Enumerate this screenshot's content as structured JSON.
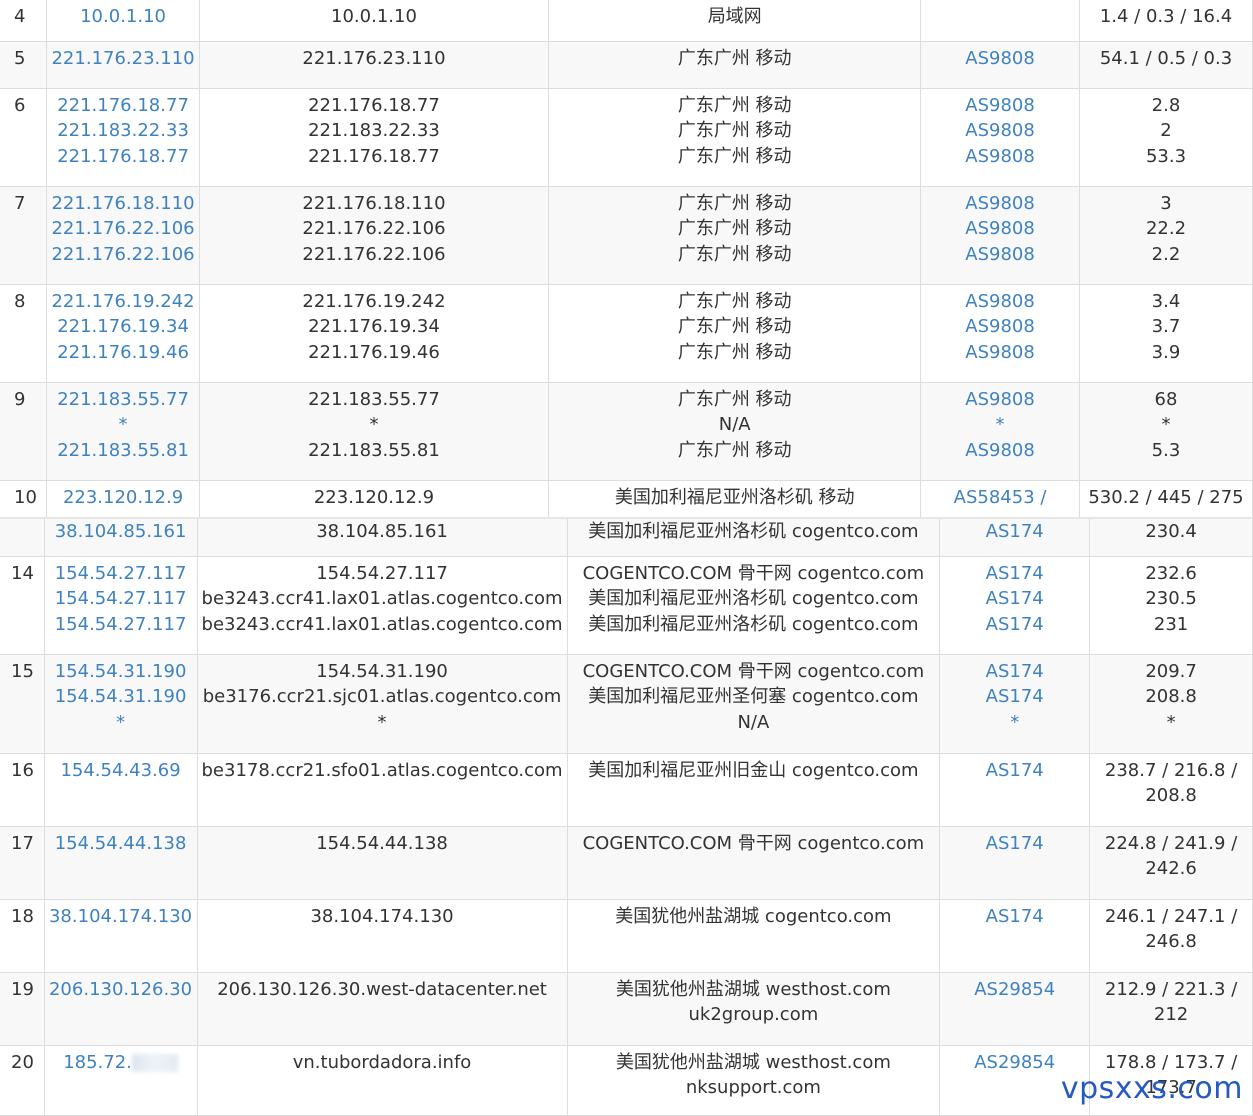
{
  "top_rows": [
    {
      "hop": "4",
      "ips": [
        "10.0.1.10"
      ],
      "hosts": [
        "10.0.1.10"
      ],
      "locs": [
        "局域网"
      ],
      "asns": [
        ""
      ],
      "times": [
        "1.4 / 0.3 / 16.4"
      ],
      "h": 41
    },
    {
      "hop": "5",
      "ips": [
        "221.176.23.110"
      ],
      "hosts": [
        "221.176.23.110"
      ],
      "locs": [
        "广东广州 移动"
      ],
      "asns": [
        "AS9808"
      ],
      "times": [
        "54.1 / 0.5 / 0.3"
      ],
      "h": 47
    },
    {
      "hop": "6",
      "ips": [
        "221.176.18.77",
        "221.183.22.33",
        "221.176.18.77"
      ],
      "hosts": [
        "221.176.18.77",
        "221.183.22.33",
        "221.176.18.77"
      ],
      "locs": [
        "广东广州 移动",
        "广东广州 移动",
        "广东广州 移动"
      ],
      "asns": [
        "AS9808",
        "AS9808",
        "AS9808"
      ],
      "times": [
        "2.8",
        "2",
        "53.3"
      ],
      "h": 98
    },
    {
      "hop": "7",
      "ips": [
        "221.176.18.110",
        "221.176.22.106",
        "221.176.22.106"
      ],
      "hosts": [
        "221.176.18.110",
        "221.176.22.106",
        "221.176.22.106"
      ],
      "locs": [
        "广东广州 移动",
        "广东广州 移动",
        "广东广州 移动"
      ],
      "asns": [
        "AS9808",
        "AS9808",
        "AS9808"
      ],
      "times": [
        "3",
        "22.2",
        "2.2"
      ],
      "h": 98
    },
    {
      "hop": "8",
      "ips": [
        "221.176.19.242",
        "221.176.19.34",
        "221.176.19.46"
      ],
      "hosts": [
        "221.176.19.242",
        "221.176.19.34",
        "221.176.19.46"
      ],
      "locs": [
        "广东广州 移动",
        "广东广州 移动",
        "广东广州 移动"
      ],
      "asns": [
        "AS9808",
        "AS9808",
        "AS9808"
      ],
      "times": [
        "3.4",
        "3.7",
        "3.9"
      ],
      "h": 98
    },
    {
      "hop": "9",
      "ips": [
        "221.183.55.77",
        "*",
        "221.183.55.81"
      ],
      "hosts": [
        "221.183.55.77",
        "*",
        "221.183.55.81"
      ],
      "locs": [
        "广东广州 移动",
        "N/A",
        "广东广州 移动"
      ],
      "asns": [
        "AS9808",
        "*",
        "AS9808"
      ],
      "times": [
        "68",
        "*",
        "5.3"
      ],
      "h": 98
    },
    {
      "hop": "10",
      "ips": [
        "223.120.12.9"
      ],
      "hosts": [
        "223.120.12.9"
      ],
      "locs": [
        "美国加利福尼亚州洛杉矶 移动"
      ],
      "asns": [
        "AS58453 /"
      ],
      "times": [
        "530.2 / 445 / 275"
      ],
      "h": 38
    }
  ],
  "bottom_rows": [
    {
      "hop": "",
      "ips": [
        "38.104.85.161"
      ],
      "hosts": [
        "38.104.85.161"
      ],
      "locs": [
        "美国加利福尼亚州洛杉矶 cogentco.com"
      ],
      "asns": [
        "AS174"
      ],
      "times": [
        "230.4"
      ],
      "h": 37,
      "offset": true
    },
    {
      "hop": "14",
      "ips": [
        "154.54.27.117",
        "154.54.27.117",
        "154.54.27.117"
      ],
      "hosts": [
        "154.54.27.117",
        "be3243.ccr41.lax01.atlas.cogentco.com",
        "be3243.ccr41.lax01.atlas.cogentco.com"
      ],
      "locs": [
        "COGENTCO.COM 骨干网 cogentco.com",
        "美国加利福尼亚州洛杉矶 cogentco.com",
        "美国加利福尼亚州洛杉矶 cogentco.com"
      ],
      "asns": [
        "AS174",
        "AS174",
        "AS174"
      ],
      "times": [
        "232.6",
        "230.5",
        "231"
      ],
      "h": 98
    },
    {
      "hop": "15",
      "ips": [
        "154.54.31.190",
        "154.54.31.190",
        "*"
      ],
      "hosts": [
        "154.54.31.190",
        "be3176.ccr21.sjc01.atlas.cogentco.com",
        "*"
      ],
      "locs": [
        "COGENTCO.COM 骨干网 cogentco.com",
        "美国加利福尼亚州圣何塞 cogentco.com",
        "N/A"
      ],
      "asns": [
        "AS174",
        "AS174",
        "*"
      ],
      "times": [
        "209.7",
        "208.8",
        "*"
      ],
      "h": 99
    },
    {
      "hop": "16",
      "ips": [
        "154.54.43.69"
      ],
      "hosts": [
        "be3178.ccr21.sfo01.atlas.cogentco.com"
      ],
      "locs": [
        "美国加利福尼亚州旧金山 cogentco.com"
      ],
      "asns": [
        "AS174"
      ],
      "times": [
        "238.7 / 216.8 /",
        "208.8"
      ],
      "h": 73
    },
    {
      "hop": "17",
      "ips": [
        "154.54.44.138"
      ],
      "hosts": [
        "154.54.44.138"
      ],
      "locs": [
        "COGENTCO.COM 骨干网 cogentco.com"
      ],
      "asns": [
        "AS174"
      ],
      "times": [
        "224.8 / 241.9 /",
        "242.6"
      ],
      "h": 73
    },
    {
      "hop": "18",
      "ips": [
        "38.104.174.130"
      ],
      "hosts": [
        "38.104.174.130"
      ],
      "locs": [
        "美国犹他州盐湖城 cogentco.com"
      ],
      "asns": [
        "AS174"
      ],
      "times": [
        "246.1 / 247.1 /",
        "246.8"
      ],
      "h": 73
    },
    {
      "hop": "19",
      "ips": [
        "206.130.126.30"
      ],
      "hosts": [
        "206.130.126.30.west-datacenter.net"
      ],
      "locs": [
        "美国犹他州盐湖城 westhost.com",
        "uk2group.com"
      ],
      "asns": [
        "AS29854"
      ],
      "times": [
        "212.9 / 221.3 /",
        "212"
      ],
      "h": 73
    },
    {
      "hop": "20",
      "ips": [
        "185.72."
      ],
      "hosts": [
        "vn.tubordadora.info"
      ],
      "locs": [
        "美国犹他州盐湖城 westhost.com",
        "nksupport.com"
      ],
      "asns": [
        "AS29854"
      ],
      "times": [
        "178.8 / 173.7 /",
        "173.7"
      ],
      "h": 70,
      "blur_ip": true
    }
  ],
  "watermark": "vpsxxs.com",
  "colors": {
    "link": "#3f82c1",
    "alt_row": "#f8f8f8",
    "border": "#dddddd",
    "watermark": "#2559c4"
  }
}
